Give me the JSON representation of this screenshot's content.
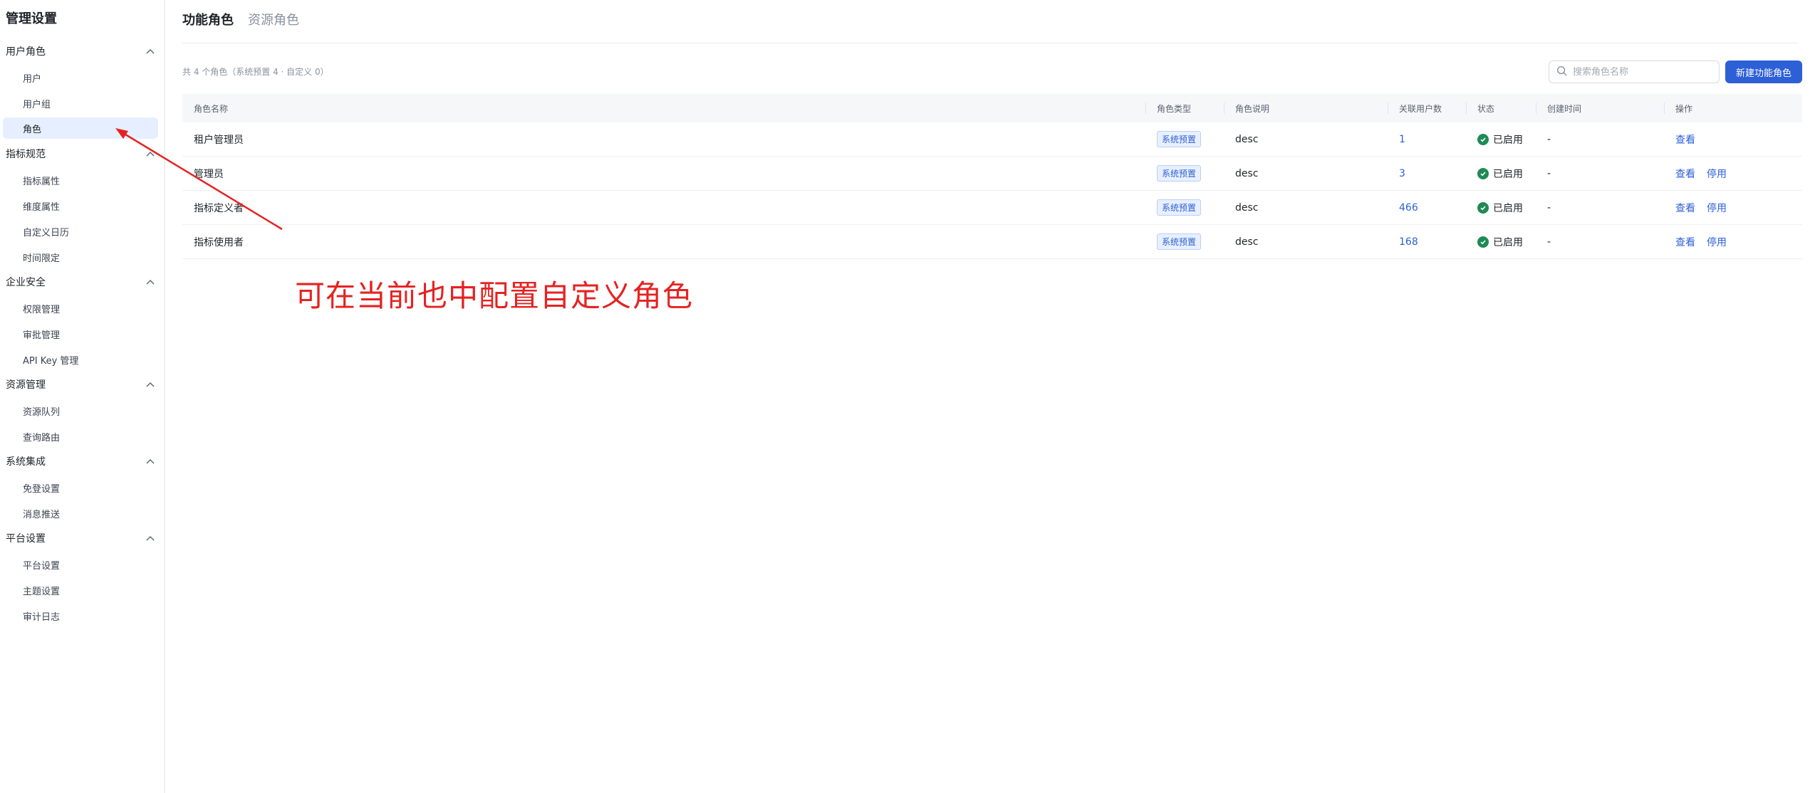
{
  "sidebar": {
    "title": "管理设置",
    "groups": [
      {
        "label": "用户角色",
        "items": [
          {
            "label": "用户"
          },
          {
            "label": "用户组"
          },
          {
            "label": "角色"
          }
        ]
      },
      {
        "label": "指标规范",
        "items": [
          {
            "label": "指标属性"
          },
          {
            "label": "维度属性"
          },
          {
            "label": "自定义日历"
          },
          {
            "label": "时间限定"
          }
        ]
      },
      {
        "label": "企业安全",
        "items": [
          {
            "label": "权限管理"
          },
          {
            "label": "审批管理"
          },
          {
            "label": "API Key 管理"
          }
        ]
      },
      {
        "label": "资源管理",
        "items": [
          {
            "label": "资源队列"
          },
          {
            "label": "查询路由"
          }
        ]
      },
      {
        "label": "系统集成",
        "items": [
          {
            "label": "免登设置"
          },
          {
            "label": "消息推送"
          }
        ]
      },
      {
        "label": "平台设置",
        "items": [
          {
            "label": "平台设置"
          },
          {
            "label": "主题设置"
          },
          {
            "label": "审计日志"
          }
        ]
      }
    ],
    "active_item": "角色"
  },
  "tabs": [
    {
      "label": "功能角色",
      "active": true
    },
    {
      "label": "资源角色",
      "active": false
    }
  ],
  "summary": "共 4 个角色（系统预置 4 · 自定义 0）",
  "search": {
    "placeholder": "搜索角色名称",
    "value": ""
  },
  "create_button": "新建功能角色",
  "table": {
    "columns": [
      "角色名称",
      "角色类型",
      "角色说明",
      "关联用户数",
      "状态",
      "创建时间",
      "操作"
    ],
    "rows": [
      {
        "name": "租户管理员",
        "type": "系统预置",
        "desc": "desc",
        "count": "1",
        "status": "已启用",
        "created": "-",
        "ops": [
          "查看"
        ]
      },
      {
        "name": "管理员",
        "type": "系统预置",
        "desc": "desc",
        "count": "3",
        "status": "已启用",
        "created": "-",
        "ops": [
          "查看",
          "停用"
        ]
      },
      {
        "name": "指标定义者",
        "type": "系统预置",
        "desc": "desc",
        "count": "466",
        "status": "已启用",
        "created": "-",
        "ops": [
          "查看",
          "停用"
        ]
      },
      {
        "name": "指标使用者",
        "type": "系统预置",
        "desc": "desc",
        "count": "168",
        "status": "已启用",
        "created": "-",
        "ops": [
          "查看",
          "停用"
        ]
      }
    ]
  },
  "annotation": {
    "text": "可在当前也中配置自定义角色",
    "color": "#e52222"
  },
  "colors": {
    "primary": "#2d5fd6",
    "success": "#1f8a55",
    "active_bg": "#e5efff"
  }
}
